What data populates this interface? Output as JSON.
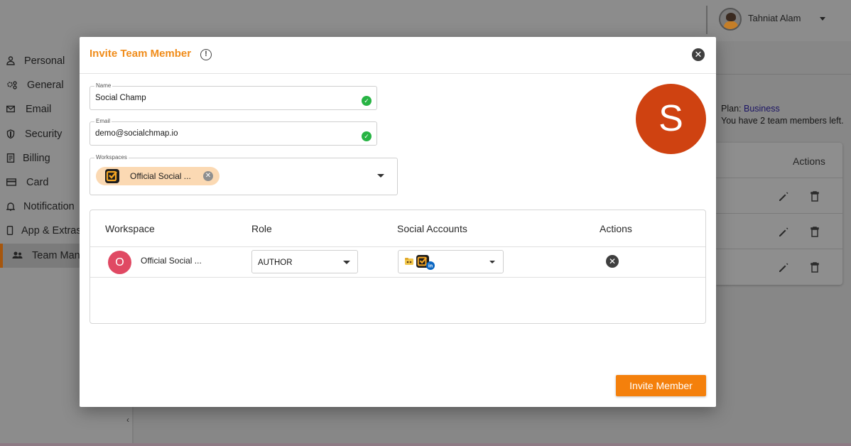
{
  "header": {
    "user_name": "Tahniat Alam",
    "avatar_icon": "user-avatar-icon",
    "menu_icon": "caret-down-icon"
  },
  "sidebar": {
    "items": [
      {
        "label": "Personal",
        "icon": "person-icon"
      },
      {
        "label": "General",
        "icon": "settings-icon"
      },
      {
        "label": "Email",
        "icon": "mail-icon"
      },
      {
        "label": "Security",
        "icon": "shield-icon"
      },
      {
        "label": "Billing",
        "icon": "document-icon"
      },
      {
        "label": "Card",
        "icon": "credit-card-icon"
      },
      {
        "label": "Notification",
        "icon": "bell-icon"
      },
      {
        "label": "App & Extras",
        "icon": "phone-icon"
      },
      {
        "label": "Team Mana",
        "icon": "people-icon",
        "active": true
      }
    ],
    "collapse_icon": "chevron-left-icon"
  },
  "background": {
    "plan_label": "Plan:",
    "plan_value": "Business",
    "members_left": "You have 2 team members left.",
    "table_header_actions": "Actions",
    "row_icons": [
      "edit-icon",
      "delete-icon"
    ]
  },
  "modal": {
    "title": "Invite Team Member",
    "info_icon": "info-icon",
    "close_icon": "close-icon",
    "name_label": "Name",
    "name_value": "Social Champ",
    "email_label": "Email",
    "email_value": "demo@socialchmap.io",
    "workspaces_label": "Workspaces",
    "workspace_chip": "Official Social ...",
    "avatar_letter": "S",
    "colors": {
      "accent": "#f08c1a",
      "button": "#f4800c",
      "avatar": "#cf4211",
      "valid": "#28b444"
    },
    "table": {
      "headers": [
        "Workspace",
        "Role",
        "Social Accounts",
        "Actions"
      ],
      "rows": [
        {
          "avatar_letter": "O",
          "workspace": "Official Social ...",
          "role": "AUTHOR",
          "accounts_icons": [
            "folder-emoji-icon",
            "social-champ-icon",
            "linkedin-icon"
          ]
        }
      ]
    },
    "invite_button": "Invite Member"
  }
}
